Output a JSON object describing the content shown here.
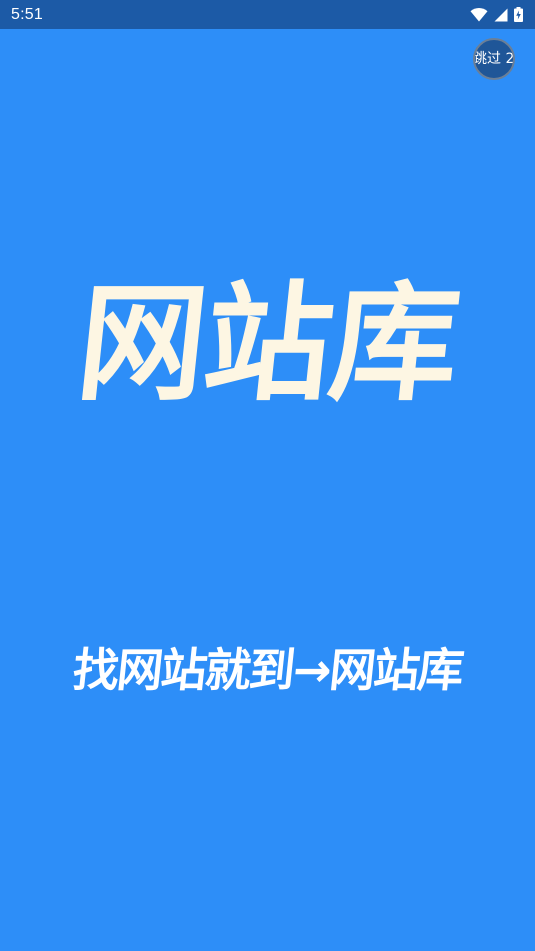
{
  "status_bar": {
    "time": "5:51",
    "icons": [
      "wifi-icon",
      "signal-icon",
      "battery-charging-icon"
    ]
  },
  "splash": {
    "skip_label": "跳过 2",
    "logo_text": "网站库",
    "slogan": "找网站就到→网站库"
  },
  "colors": {
    "background": "#2d8ef8",
    "status_bar": "#1c5aa6",
    "logo_text": "#fdf6e3",
    "slogan_text": "#ffffff",
    "skip_button": "#1f5698"
  }
}
